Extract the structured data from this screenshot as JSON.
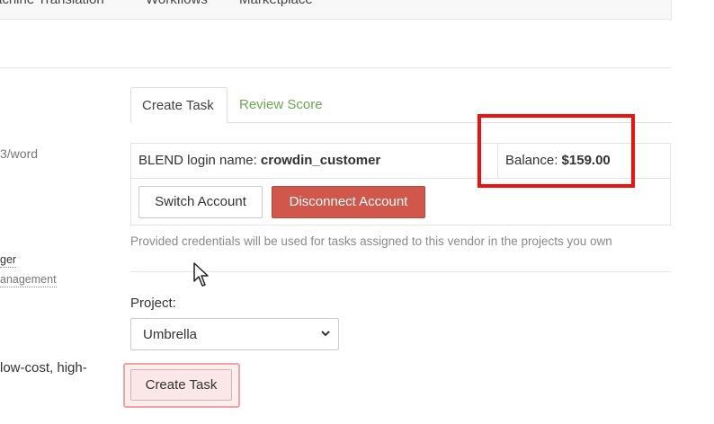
{
  "topnav": {
    "items": [
      "achine Translation",
      "Workflows",
      "Marketplace"
    ]
  },
  "left_fragments": {
    "per_word": "3/word",
    "manager_link": "ger",
    "management_link": "anagement",
    "description": "low-cost, high-"
  },
  "tabs": [
    {
      "label": "Create Task",
      "active": true
    },
    {
      "label": "Review Score",
      "active": false
    }
  ],
  "account": {
    "login_label": "BLEND login name:",
    "login_value": "crowdin_customer",
    "balance_label": "Balance:",
    "balance_value": "$159.00"
  },
  "buttons": {
    "switch_account": "Switch Account",
    "disconnect_account": "Disconnect Account",
    "create_task": "Create Task"
  },
  "help_text": "Provided credentials will be used for tasks assigned to this vendor in the projects you own",
  "project": {
    "label": "Project:",
    "selected": "Umbrella"
  },
  "colors": {
    "danger": "#d2574b",
    "link_green": "#6aa84f",
    "highlight_red": "#ee1111"
  },
  "icons": {
    "select_chevron": "chevron-updown-icon",
    "cursor": "mouse-pointer-icon"
  }
}
